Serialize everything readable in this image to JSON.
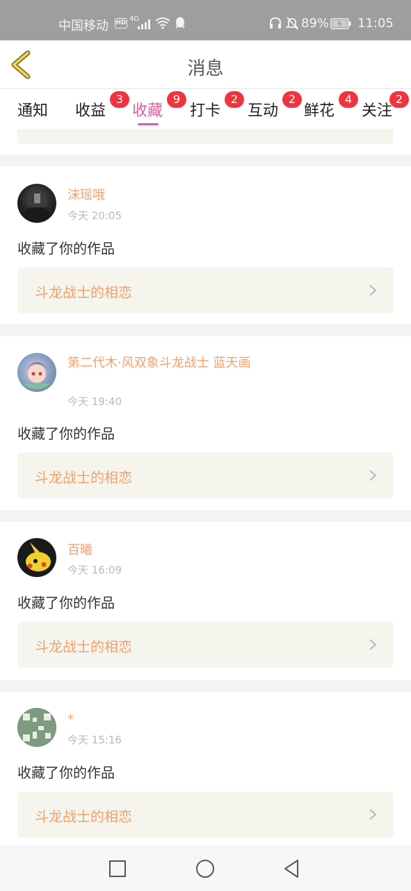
{
  "status_bar": {
    "carrier": "中国移动",
    "hd": "HD",
    "network": "4G",
    "battery_pct": "89%",
    "time": "11:05"
  },
  "header": {
    "title": "消息",
    "back_icon": "chevron-left-icon"
  },
  "tabs": [
    {
      "label": "通知",
      "badge": "",
      "active": false
    },
    {
      "label": "收益",
      "badge": "3",
      "active": false
    },
    {
      "label": "收藏",
      "badge": "9",
      "active": true
    },
    {
      "label": "打卡",
      "badge": "2",
      "active": false
    },
    {
      "label": "互动",
      "badge": "2",
      "active": false
    },
    {
      "label": "鲜花",
      "badge": "4",
      "active": false
    },
    {
      "label": "关注",
      "badge": "2",
      "active": false
    }
  ],
  "items": [
    {
      "name": "沫瑶哦",
      "time": "今天 20:05",
      "action": "收藏了你的作品",
      "work": "斗龙战士的相恋"
    },
    {
      "name": "第二代木·风双象斗龙战士 蓝天画",
      "time": "今天 19:40",
      "action": "收藏了你的作品",
      "work": "斗龙战士的相恋"
    },
    {
      "name": "百曦",
      "time": "今天 16:09",
      "action": "收藏了你的作品",
      "work": "斗龙战士的相恋"
    },
    {
      "name": "*",
      "time": "今天 15:16",
      "action": "收藏了你的作品",
      "work": "斗龙战士的相恋"
    }
  ],
  "colors": {
    "accent_pink": "#e05a9c",
    "name_orange": "#f0a06c",
    "badge_red": "#f0333f",
    "card_bg": "#f5f5ee"
  },
  "navbar": {
    "icons": [
      "square-recent-apps-icon",
      "circle-home-icon",
      "triangle-back-icon"
    ]
  }
}
